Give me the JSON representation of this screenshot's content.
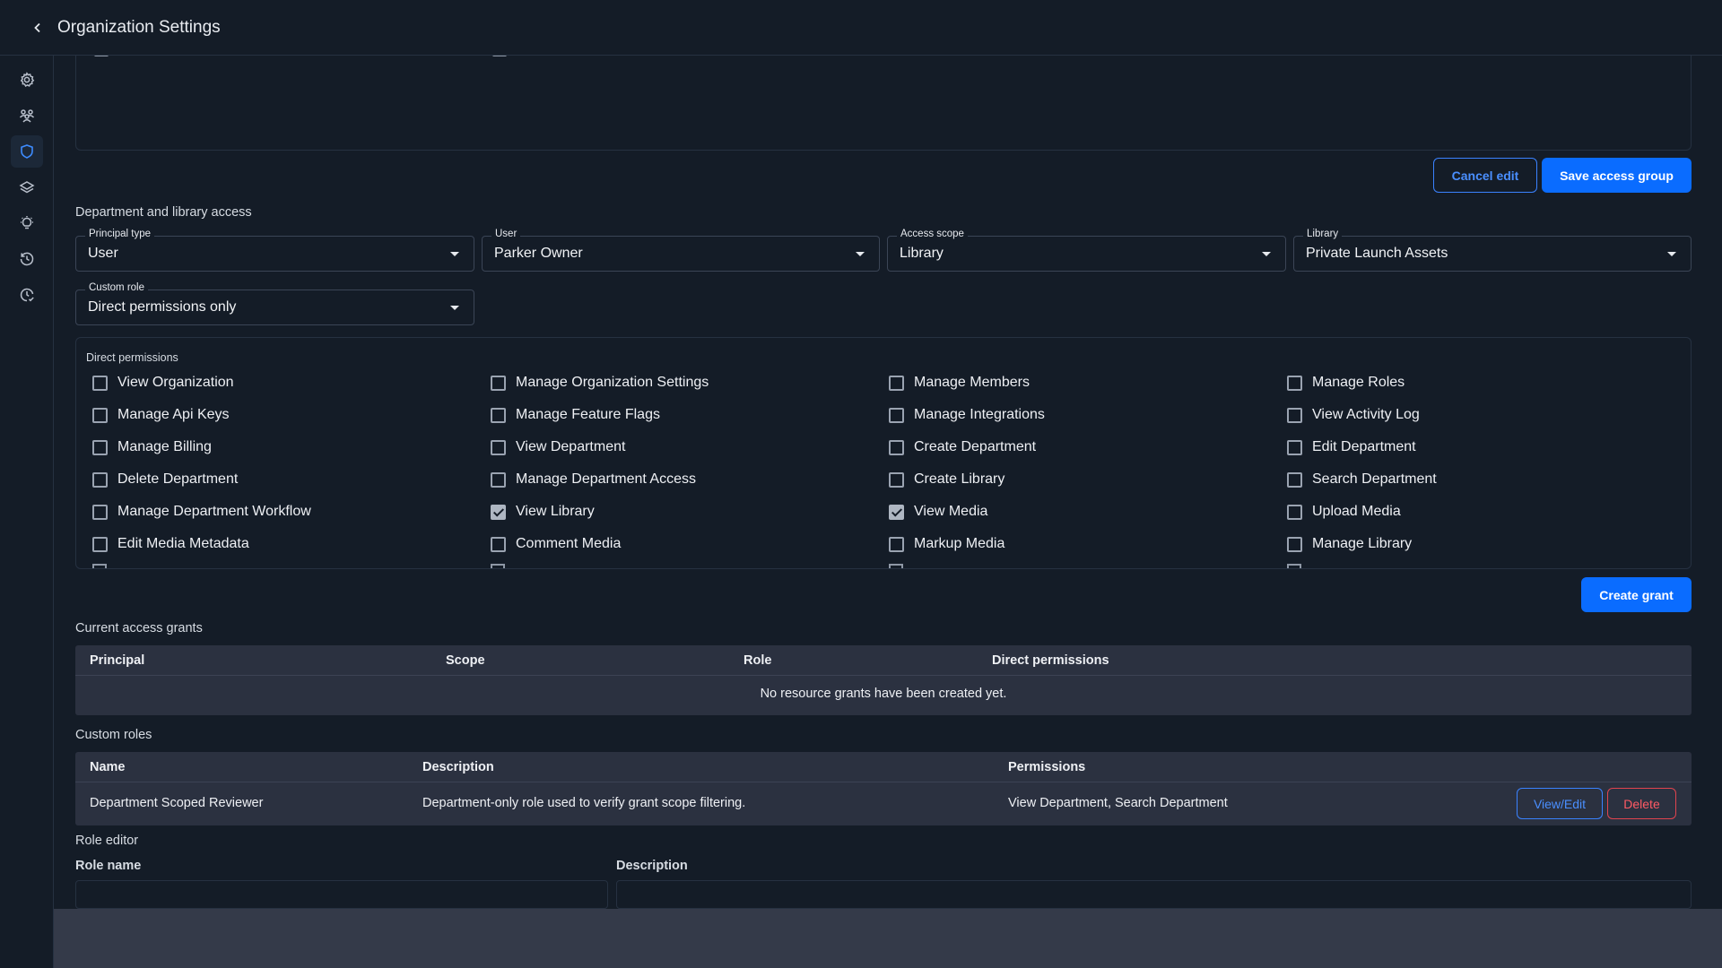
{
  "header": {
    "title": "Organization Settings"
  },
  "sidebar": {
    "items": [
      {
        "icon": "gear-icon",
        "active": false
      },
      {
        "icon": "users-icon",
        "active": false
      },
      {
        "icon": "shield-icon",
        "active": true
      },
      {
        "icon": "layers-icon",
        "active": false
      },
      {
        "icon": "lightbulb-icon",
        "active": false
      },
      {
        "icon": "history-icon",
        "active": false
      },
      {
        "icon": "clock-check-icon",
        "active": false
      }
    ]
  },
  "access_group": {
    "cancel_label": "Cancel edit",
    "save_label": "Save access group"
  },
  "grant_form": {
    "section_title": "Department and library access",
    "principal_type": {
      "label": "Principal type",
      "value": "User"
    },
    "user": {
      "label": "User",
      "value": "Parker Owner"
    },
    "access_scope": {
      "label": "Access scope",
      "value": "Library"
    },
    "library": {
      "label": "Library",
      "value": "Private Launch Assets"
    },
    "custom_role": {
      "label": "Custom role",
      "value": "Direct permissions only"
    },
    "permissions_title": "Direct permissions",
    "permissions": [
      {
        "label": "View Organization",
        "checked": false
      },
      {
        "label": "Manage Organization Settings",
        "checked": false
      },
      {
        "label": "Manage Members",
        "checked": false
      },
      {
        "label": "Manage Roles",
        "checked": false
      },
      {
        "label": "Manage Api Keys",
        "checked": false
      },
      {
        "label": "Manage Feature Flags",
        "checked": false
      },
      {
        "label": "Manage Integrations",
        "checked": false
      },
      {
        "label": "View Activity Log",
        "checked": false
      },
      {
        "label": "Manage Billing",
        "checked": false
      },
      {
        "label": "View Department",
        "checked": false
      },
      {
        "label": "Create Department",
        "checked": false
      },
      {
        "label": "Edit Department",
        "checked": false
      },
      {
        "label": "Delete Department",
        "checked": false
      },
      {
        "label": "Manage Department Access",
        "checked": false
      },
      {
        "label": "Create Library",
        "checked": false
      },
      {
        "label": "Search Department",
        "checked": false
      },
      {
        "label": "Manage Department Workflow",
        "checked": false
      },
      {
        "label": "View Library",
        "checked": true
      },
      {
        "label": "View Media",
        "checked": true
      },
      {
        "label": "Upload Media",
        "checked": false
      },
      {
        "label": "Edit Media Metadata",
        "checked": false
      },
      {
        "label": "Comment Media",
        "checked": false
      },
      {
        "label": "Markup Media",
        "checked": false
      },
      {
        "label": "Manage Library",
        "checked": false
      }
    ],
    "create_label": "Create grant"
  },
  "grants": {
    "section_title": "Current access grants",
    "columns": [
      "Principal",
      "Scope",
      "Role",
      "Direct permissions"
    ],
    "empty_message": "No resource grants have been created yet."
  },
  "custom_roles": {
    "section_title": "Custom roles",
    "columns": [
      "Name",
      "Description",
      "Permissions"
    ],
    "rows": [
      {
        "name": "Department Scoped Reviewer",
        "description": "Department-only role used to verify grant scope filtering.",
        "permissions": "View Department, Search Department",
        "edit_label": "View/Edit",
        "delete_label": "Delete"
      }
    ]
  },
  "role_editor": {
    "section_title": "Role editor",
    "name_label": "Role name",
    "name_value": "",
    "description_label": "Description",
    "description_value": ""
  }
}
